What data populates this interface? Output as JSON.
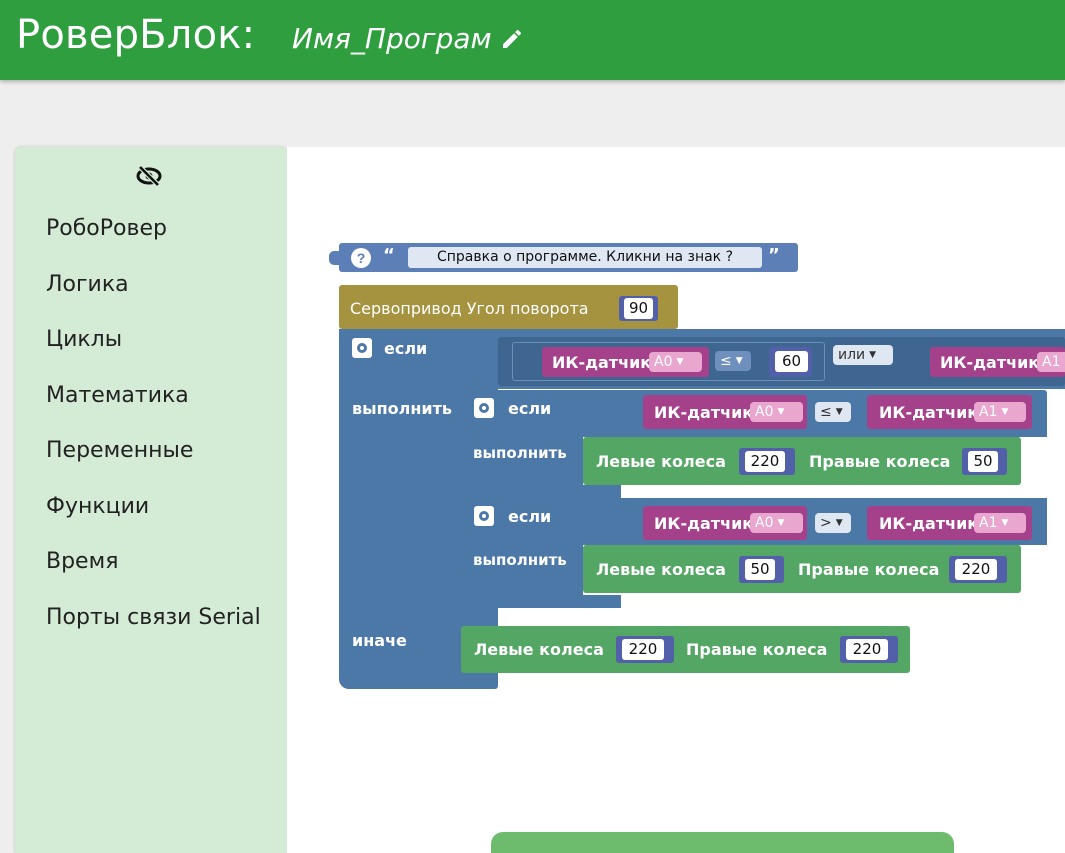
{
  "header": {
    "app_title": "РоверБлок:",
    "program_name": "Имя_Програм"
  },
  "sidebar": {
    "items": [
      {
        "label": "РобоРовер"
      },
      {
        "label": "Логика"
      },
      {
        "label": "Циклы"
      },
      {
        "label": "Математика"
      },
      {
        "label": "Переменные"
      },
      {
        "label": "Функции"
      },
      {
        "label": "Время"
      },
      {
        "label": "Порты связи Serial"
      }
    ]
  },
  "workspace": {
    "comment": {
      "open_quote": "“",
      "text": "Справка о программе. Кликни на знак ?",
      "close_quote": "”"
    },
    "servo": {
      "label": "Сервопривод Угол поворота",
      "value": "90"
    },
    "if_main": {
      "if_label": "если",
      "do_label": "выполнить",
      "else_label": "иначе",
      "cond1": {
        "sensor_label": "ИК-датчик",
        "port": "A0",
        "op": "≤",
        "value": "60"
      },
      "logic_op": "или",
      "cond2": {
        "sensor_label": "ИК-датчик",
        "port": "A1"
      }
    },
    "if_inner1": {
      "if_label": "если",
      "do_label": "выполнить",
      "left": {
        "sensor_label": "ИК-датчик",
        "port": "A0"
      },
      "op": "≤",
      "right": {
        "sensor_label": "ИК-датчик",
        "port": "A1"
      },
      "wheels": {
        "left_label": "Левые колеса",
        "left_value": "220",
        "right_label": "Правые колеса",
        "right_value": "50"
      }
    },
    "if_inner2": {
      "if_label": "если",
      "do_label": "выполнить",
      "left": {
        "sensor_label": "ИК-датчик",
        "port": "A0"
      },
      "op": ">",
      "right": {
        "sensor_label": "ИК-датчик",
        "port": "A1"
      },
      "wheels": {
        "left_label": "Левые колеса",
        "left_value": "50",
        "right_label": "Правые колеса",
        "right_value": "220"
      }
    },
    "else_wheels": {
      "left_label": "Левые колеса",
      "left_value": "220",
      "right_label": "Правые колеса",
      "right_value": "220"
    }
  },
  "colors": {
    "header": "#2e9e3f",
    "sidebar": "#d4ebd5",
    "logic_block": "#4c78a8",
    "sensor_block": "#a5418a",
    "motor_block": "#53a664",
    "servo_block": "#a59340",
    "number_block": "#5260a9"
  },
  "icons": {
    "pencil": "pencil-icon",
    "eye": "eye-slash-icon",
    "gear": "gear-icon",
    "help": "help-icon"
  }
}
